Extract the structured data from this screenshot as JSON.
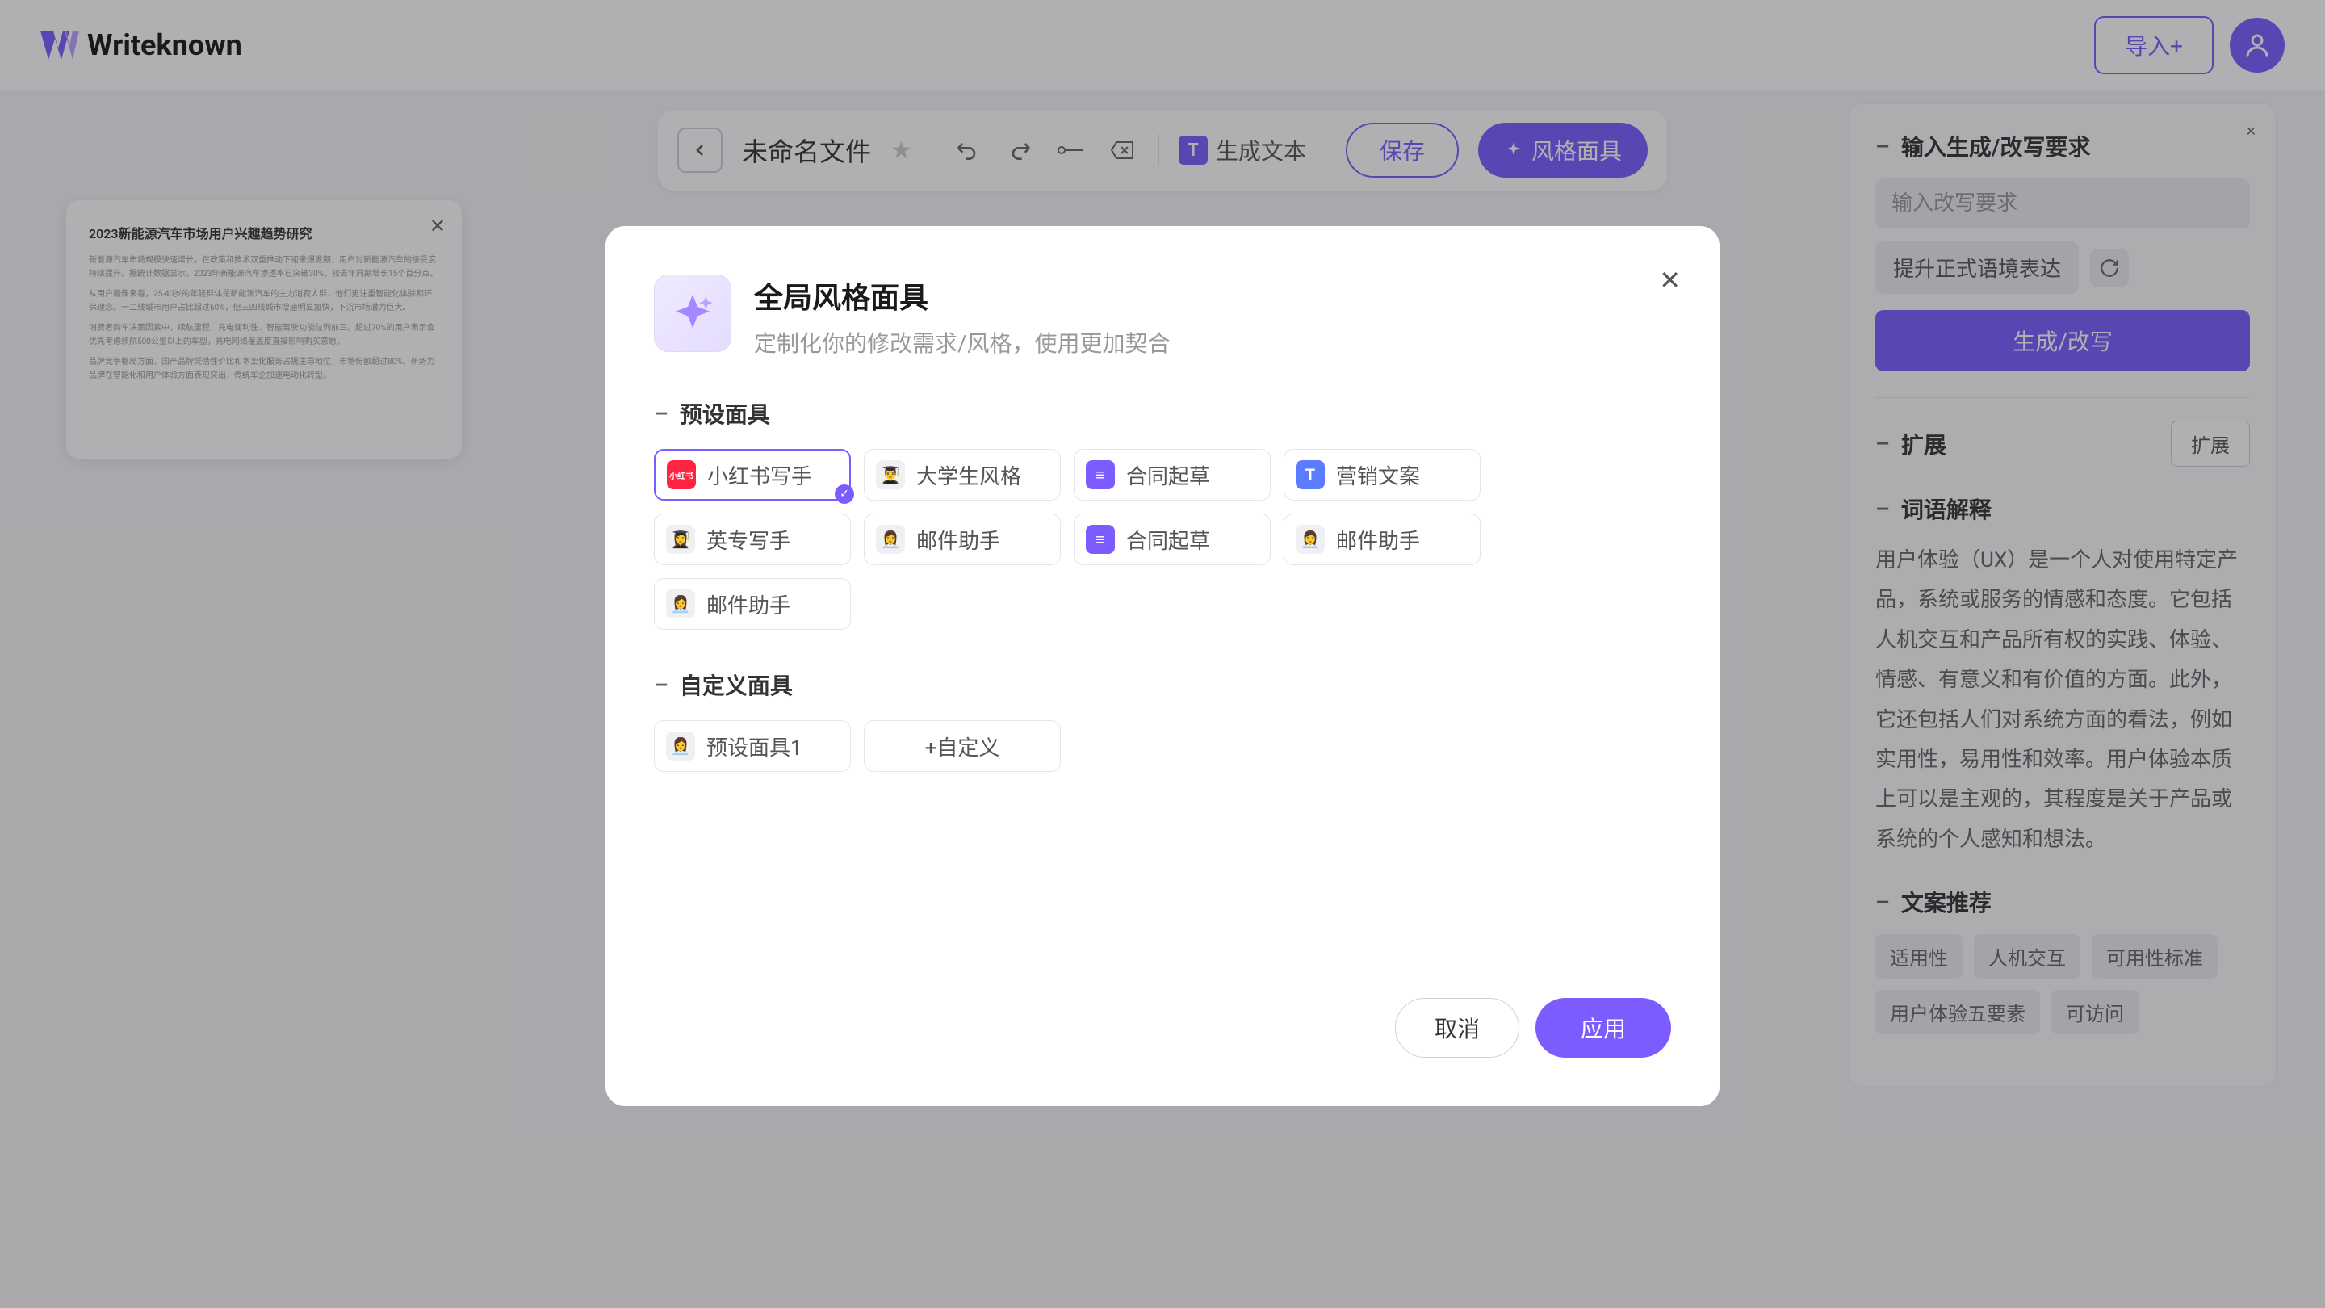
{
  "brand": "Writeknown",
  "header": {
    "import_btn": "导入+"
  },
  "toolbar": {
    "file_title": "未命名文件",
    "gen_text": "生成文本",
    "save": "保存",
    "style_mask": "风格面具"
  },
  "doc_card": {
    "title": "2023新能源汽车市场用户兴趣趋势研究",
    "p1": "新能源汽车市场规模快速增长，在政策和技术双重推动下迎来爆发期，用户对新能源汽车的接受度持续提升。据统计数据显示，2023年新能源汽车渗透率已突破30%，较去年同期增长15个百分点。",
    "p2": "从用户画像来看，25-40岁的年轻群体是新能源汽车的主力消费人群，他们更注重智能化体验和环保理念。一二线城市用户占比超过60%，但三四线城市增速明显加快，下沉市场潜力巨大。",
    "p3": "消费者购车决策因素中，续航里程、充电便利性、智能驾驶功能位列前三。超过70%的用户表示会优先考虑续航500公里以上的车型，充电网络覆盖度直接影响购买意愿。",
    "p4": "品牌竞争格局方面，国产品牌凭借性价比和本土化服务占据主导地位，市场份额超过80%。新势力品牌在智能化和用户体验方面表现突出，传统车企加速电动化转型。"
  },
  "sidebar": {
    "section1_title": "输入生成/改写要求",
    "input_placeholder": "输入改写要求",
    "suggestion": "提升正式语境表达",
    "primary_btn": "生成/改写",
    "section2_title": "扩展",
    "expand_btn": "扩展",
    "section3_title": "词语解释",
    "explain_text": "用户体验（UX）是一个人对使用特定产品，系统或服务的情感和态度。它包括人机交互和产品所有权的实践、体验、情感、有意义和有价值的方面。此外，它还包括人们对系统方面的看法，例如实用性，易用性和效率。用户体验本质上可以是主观的，其程度是关于产品或系统的个人感知和想法。",
    "section4_title": "文案推荐",
    "chips": [
      "适用性",
      "人机交互",
      "可用性标准",
      "用户体验五要素",
      "可访问"
    ]
  },
  "modal": {
    "title": "全局风格面具",
    "subtitle": "定制化你的修改需求/风格，使用更加契合",
    "preset_title": "预设面具",
    "custom_title": "自定义面具",
    "presets": [
      {
        "label": "小红书写手",
        "badge_type": "red",
        "badge_text": "小红书",
        "selected": true
      },
      {
        "label": "大学生风格",
        "badge_type": "emoji",
        "badge_text": "👨‍🎓"
      },
      {
        "label": "合同起草",
        "badge_type": "purple",
        "badge_text": "≡"
      },
      {
        "label": "营销文案",
        "badge_type": "blue",
        "badge_text": "T"
      },
      {
        "label": "英专写手",
        "badge_type": "emoji",
        "badge_text": "👩‍🎓"
      },
      {
        "label": "邮件助手",
        "badge_type": "emoji",
        "badge_text": "👩‍💼"
      },
      {
        "label": "合同起草",
        "badge_type": "purple",
        "badge_text": "≡"
      },
      {
        "label": "邮件助手",
        "badge_type": "emoji",
        "badge_text": "👩‍💼"
      },
      {
        "label": "邮件助手",
        "badge_type": "emoji",
        "badge_text": "👩‍💼"
      }
    ],
    "custom": [
      {
        "label": "预设面具1",
        "badge_type": "emoji",
        "badge_text": "👩‍💼"
      }
    ],
    "add_custom": "+自定义",
    "cancel": "取消",
    "apply": "应用"
  }
}
